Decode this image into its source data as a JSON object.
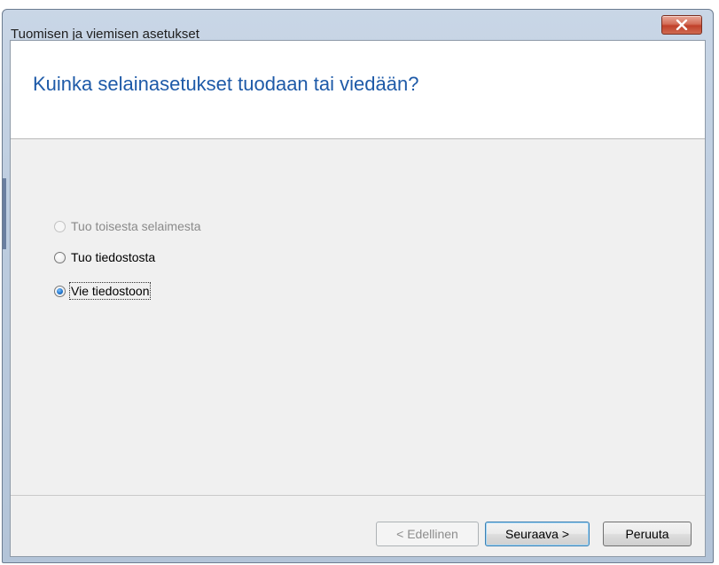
{
  "window": {
    "title": "Tuomisen ja viemisen asetukset",
    "close_icon": "close-icon"
  },
  "header": {
    "heading": "Kuinka selainasetukset tuodaan tai viedään?"
  },
  "options": [
    {
      "label": "Tuo toisesta selaimesta",
      "enabled": false,
      "selected": false
    },
    {
      "label": "Tuo tiedostosta",
      "enabled": true,
      "selected": false
    },
    {
      "label": "Vie tiedostoon",
      "enabled": true,
      "selected": true
    }
  ],
  "buttons": {
    "back_label": "< Edellinen",
    "next_label": "Seuraava >",
    "cancel_label": "Peruuta"
  },
  "colors": {
    "heading": "#1e5aa8",
    "close_button": "#c0402a"
  }
}
